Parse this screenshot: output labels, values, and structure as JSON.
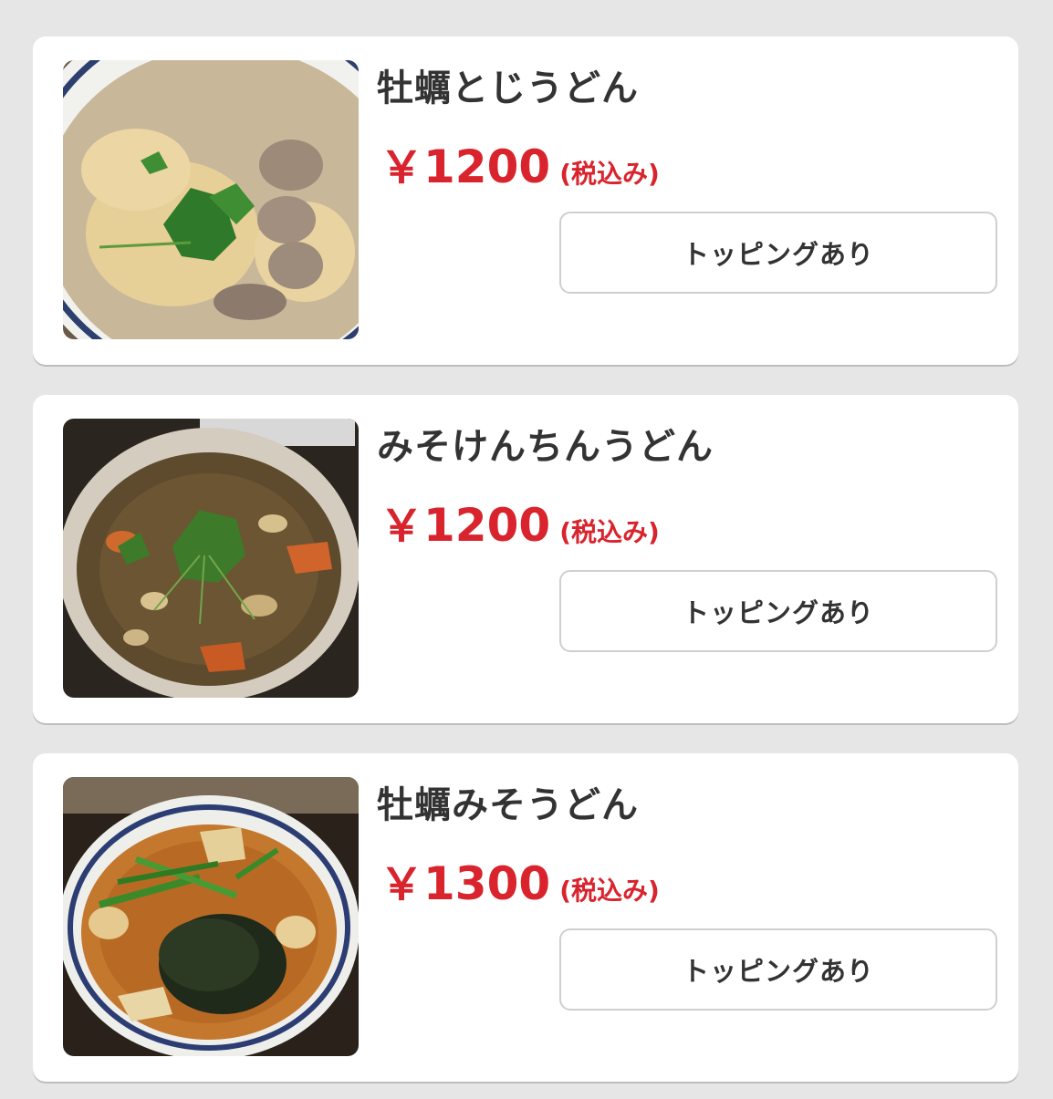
{
  "menu": {
    "items": [
      {
        "name": "牡蠣とじうどん",
        "price_symbol": "￥",
        "price": "1200",
        "tax_note": "(税込み)",
        "button_label": "トッピングあり"
      },
      {
        "name": "みそけんちんうどん",
        "price_symbol": "￥",
        "price": "1200",
        "tax_note": "(税込み)",
        "button_label": "トッピングあり"
      },
      {
        "name": "牡蠣みそうどん",
        "price_symbol": "￥",
        "price": "1300",
        "tax_note": "(税込み)",
        "button_label": "トッピングあり"
      }
    ]
  },
  "colors": {
    "background": "#e6e6e6",
    "card": "#ffffff",
    "price": "#d9232d",
    "text": "#333333",
    "button_border": "#cfcfcf"
  }
}
